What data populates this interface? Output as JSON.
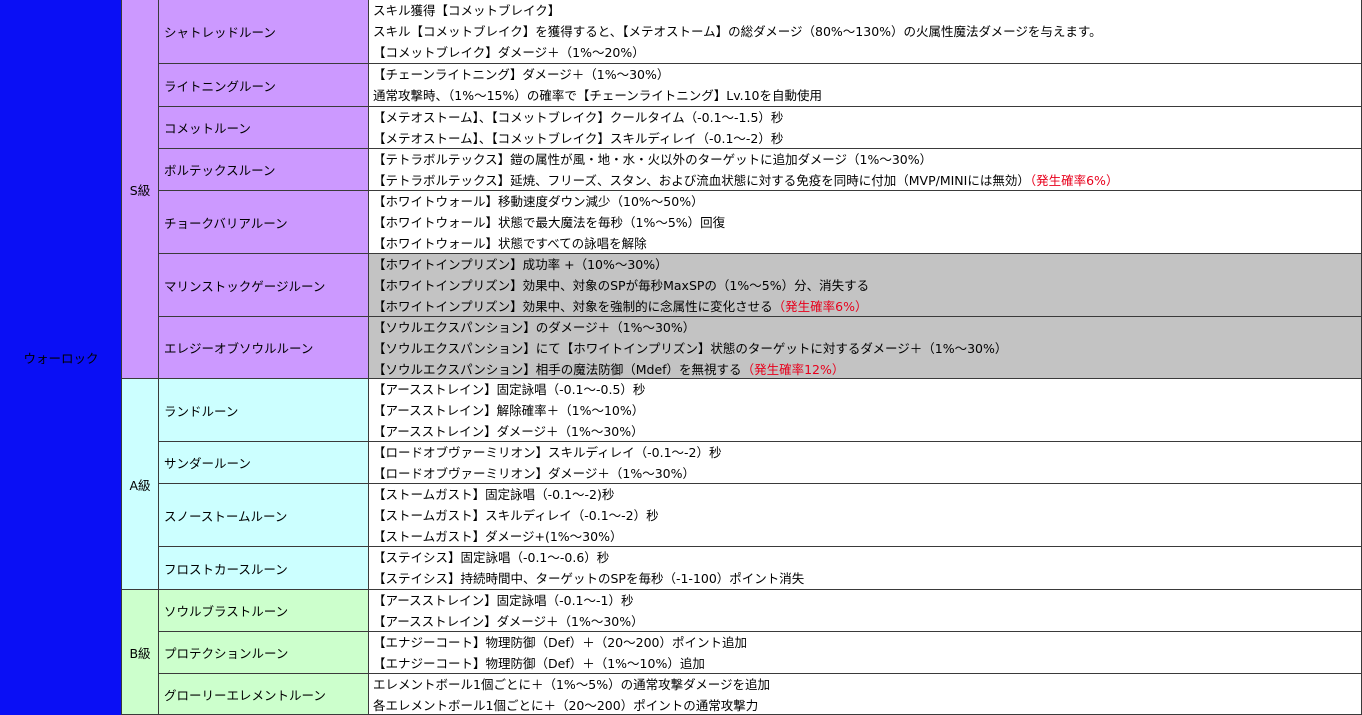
{
  "class_name": "ウォーロック",
  "colors": {
    "class_bg": "#0a0ff5",
    "grade_s": "#cc99ff",
    "grade_a": "#ccffff",
    "grade_b": "#ccffcc",
    "highlight_row": "#c3c3c3",
    "proc_text": "#e8001c"
  },
  "grades": [
    {
      "label": "S級"
    },
    {
      "label": "A級"
    },
    {
      "label": "B級"
    }
  ],
  "runes": [
    {
      "name": "シャトレッドルーン",
      "lines": [
        {
          "text": "スキル獲得【コメットブレイク】",
          "proc": ""
        },
        {
          "text": "スキル【コメットブレイク】を獲得すると、【メテオストーム】の総ダメージ（80%～130%）の火属性魔法ダメージを与えます。",
          "proc": ""
        },
        {
          "text": "【コメットブレイク】ダメージ＋（1%～20%）",
          "proc": ""
        }
      ]
    },
    {
      "name": "ライトニングルーン",
      "lines": [
        {
          "text": "【チェーンライトニング】ダメージ＋（1%～30%）",
          "proc": ""
        },
        {
          "text": "通常攻撃時、（1%～15%）の確率で【チェーンライトニング】Lv.10を自動使用",
          "proc": ""
        }
      ]
    },
    {
      "name": "コメットルーン",
      "lines": [
        {
          "text": "【メテオストーム】、【コメットブレイク】クールタイム（-0.1～-1.5）秒",
          "proc": ""
        },
        {
          "text": "【メテオストーム】、【コメットブレイク】スキルディレイ（-0.1～-2）秒",
          "proc": ""
        }
      ]
    },
    {
      "name": "ボルテックスルーン",
      "lines": [
        {
          "text": "【テトラボルテックス】鎧の属性が風・地・水・火以外のターゲットに追加ダメージ（1%～30%）",
          "proc": ""
        },
        {
          "text": "【テトラボルテックス】延焼、フリーズ、スタン、および流血状態に対する免疫を同時に付加（MVP/MINIには無効）",
          "proc": "（発生確率6%）"
        }
      ]
    },
    {
      "name": "チョークバリアルーン",
      "lines": [
        {
          "text": "【ホワイトウォール】移動速度ダウン減少（10%～50%）",
          "proc": ""
        },
        {
          "text": "【ホワイトウォール】状態で最大魔法を毎秒（1%～5%）回復",
          "proc": ""
        },
        {
          "text": "【ホワイトウォール】状態ですべての詠唱を解除",
          "proc": ""
        }
      ]
    },
    {
      "name": "マリンストックゲージルーン",
      "lines": [
        {
          "text": "【ホワイトインプリズン】成功率 +（10%～30%）",
          "proc": ""
        },
        {
          "text": "【ホワイトインプリズン】効果中、対象のSPが毎秒MaxSPの（1%～5%）分、消失する",
          "proc": ""
        },
        {
          "text": "【ホワイトインプリズン】効果中、対象を強制的に念属性に変化させる",
          "proc": "（発生確率6%）"
        }
      ]
    },
    {
      "name": "エレジーオブソウルルーン",
      "lines": [
        {
          "text": "【ソウルエクスパンション】のダメージ＋（1%～30%）",
          "proc": ""
        },
        {
          "text": "【ソウルエクスパンション】にて【ホワイトインプリズン】状態のターゲットに対するダメージ＋（1%～30%）",
          "proc": ""
        },
        {
          "text": "【ソウルエクスパンション】相手の魔法防御（Mdef）を無視する",
          "proc": "（発生確率12%）"
        }
      ]
    },
    {
      "name": "ランドルーン",
      "lines": [
        {
          "text": "【アースストレイン】固定詠唱（-0.1～-0.5）秒",
          "proc": ""
        },
        {
          "text": "【アースストレイン】解除確率＋（1%～10%）",
          "proc": ""
        },
        {
          "text": "【アースストレイン】ダメージ＋（1%～30%）",
          "proc": ""
        }
      ]
    },
    {
      "name": "サンダールーン",
      "lines": [
        {
          "text": "【ロードオブヴァーミリオン】スキルディレイ（-0.1～-2）秒",
          "proc": ""
        },
        {
          "text": "【ロードオブヴァーミリオン】ダメージ＋（1%～30%）",
          "proc": ""
        }
      ]
    },
    {
      "name": "スノーストームルーン",
      "lines": [
        {
          "text": "【ストームガスト】固定詠唱（-0.1～-2)秒",
          "proc": ""
        },
        {
          "text": "【ストームガスト】スキルディレイ（-0.1～-2）秒",
          "proc": ""
        },
        {
          "text": "【ストームガスト】ダメージ+(1%～30%）",
          "proc": ""
        }
      ]
    },
    {
      "name": "フロストカースルーン",
      "lines": [
        {
          "text": "【ステイシス】固定詠唱（-0.1～-0.6）秒",
          "proc": ""
        },
        {
          "text": "【ステイシス】持続時間中、ターゲットのSPを毎秒（-1-100）ポイント消失",
          "proc": ""
        }
      ]
    },
    {
      "name": "ソウルブラストルーン",
      "lines": [
        {
          "text": "【アースストレイン】固定詠唱（-0.1～-1）秒",
          "proc": ""
        },
        {
          "text": "【アースストレイン】ダメージ＋（1%～30%）",
          "proc": ""
        }
      ]
    },
    {
      "name": "プロテクションルーン",
      "lines": [
        {
          "text": "【エナジーコート】物理防御（Def）＋（20～200）ポイント追加",
          "proc": ""
        },
        {
          "text": "【エナジーコート】物理防御（Def）＋（1%～10%）追加",
          "proc": ""
        }
      ]
    },
    {
      "name": "グローリーエレメントルーン",
      "lines": [
        {
          "text": "エレメントボール1個ごとに＋（1%～5%）の通常攻撃ダメージを追加",
          "proc": ""
        },
        {
          "text": "各エレメントボール1個ごとに＋（20～200）ポイントの通常攻撃力",
          "proc": ""
        }
      ]
    }
  ]
}
